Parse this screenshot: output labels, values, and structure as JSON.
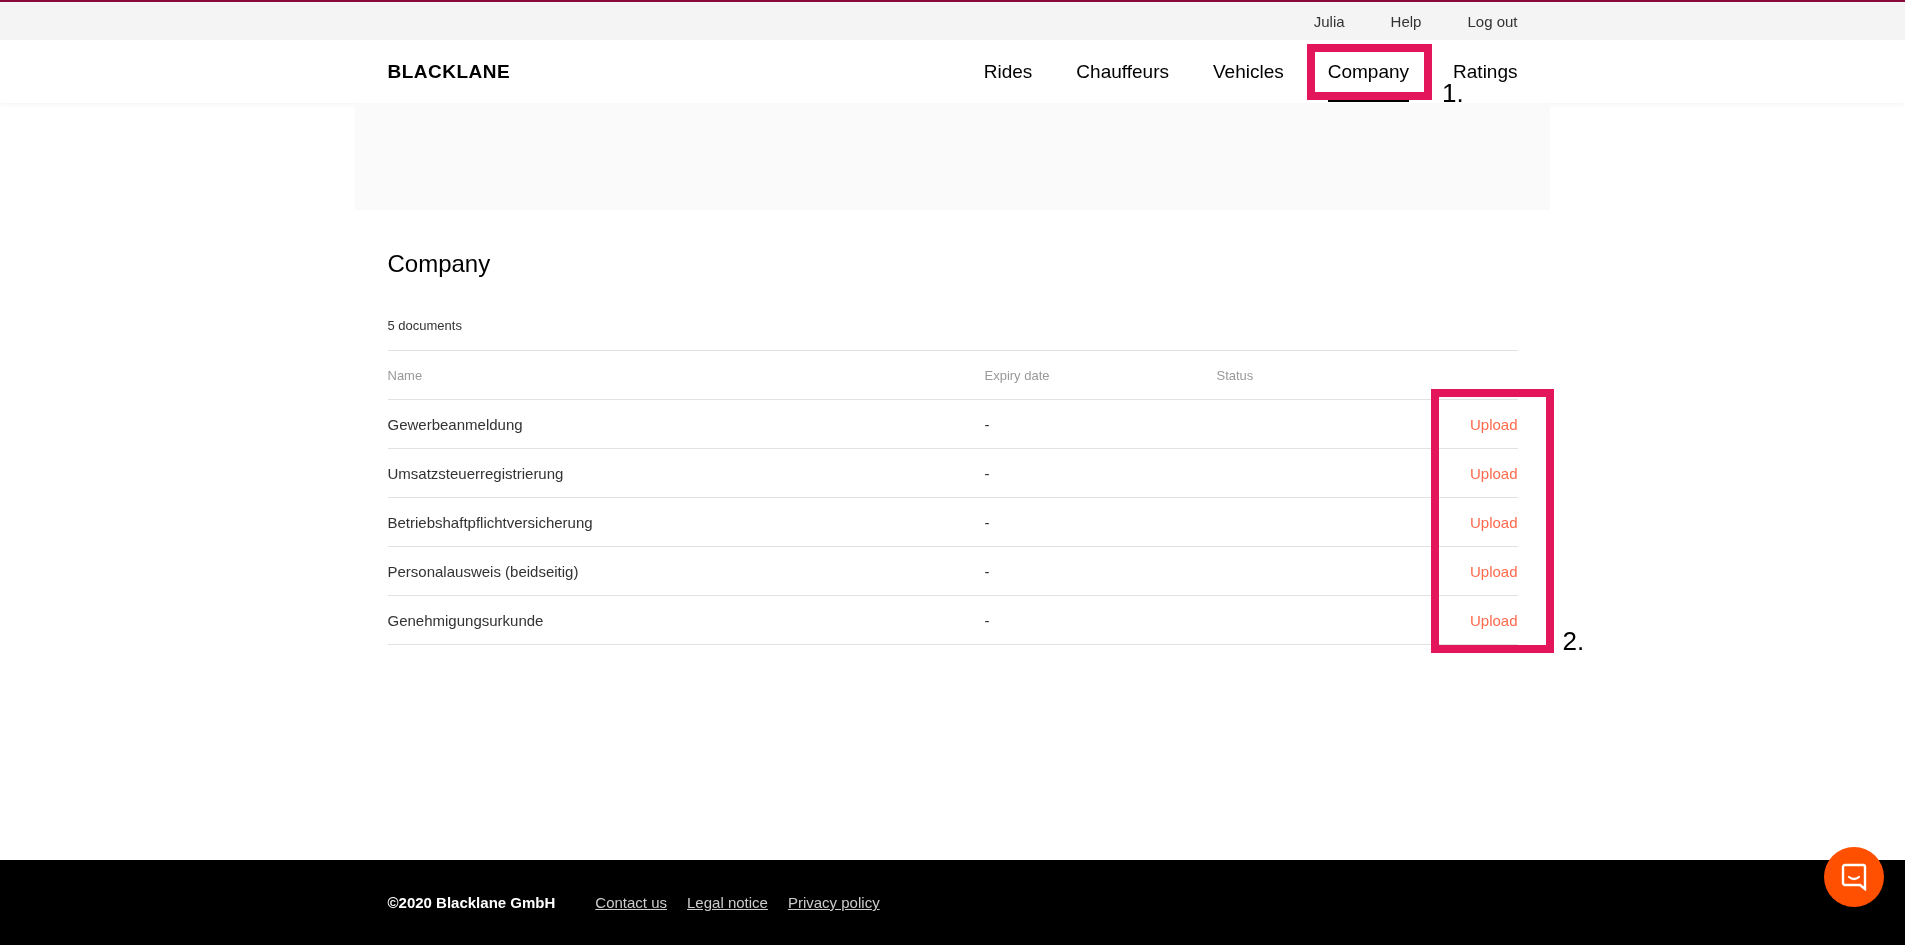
{
  "top_bar": {
    "links": [
      "Julia",
      "Help",
      "Log out"
    ]
  },
  "nav": {
    "logo": "BLACKLANE",
    "tabs": [
      {
        "label": "Rides",
        "selected": false
      },
      {
        "label": "Chauffeurs",
        "selected": false
      },
      {
        "label": "Vehicles",
        "selected": false
      },
      {
        "label": "Company",
        "selected": true,
        "marker": "1."
      },
      {
        "label": "Ratings",
        "selected": false
      }
    ]
  },
  "section": {
    "title": "Company",
    "count": "5 documents",
    "columns": [
      "Name",
      "Expiry date",
      "Status"
    ],
    "marker": "2.",
    "rows": [
      {
        "name": "Gewerbeanmeldung",
        "expiry": "-",
        "action": "Upload"
      },
      {
        "name": "Umsatzsteuerregistrierung",
        "expiry": "-",
        "action": "Upload"
      },
      {
        "name": "Betriebshaftpflichtversicherung",
        "expiry": "-",
        "action": "Upload"
      },
      {
        "name": "Personalausweis (beidseitig)",
        "expiry": "-",
        "action": "Upload"
      },
      {
        "name": "Genehmigungsurkunde",
        "expiry": "-",
        "action": "Upload"
      }
    ]
  },
  "footer": {
    "copyright": "©2020 Blacklane GmbH",
    "links": [
      "Contact us",
      "Legal notice",
      "Privacy policy"
    ]
  }
}
